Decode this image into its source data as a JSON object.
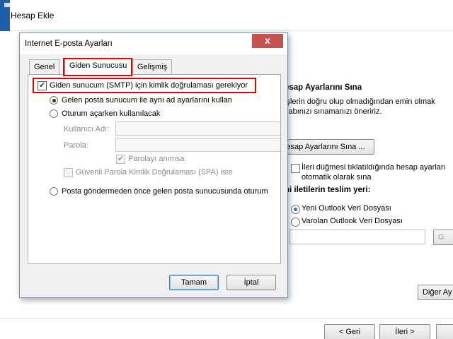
{
  "background_window": {
    "title": "Hesap Ekle",
    "test_heading": "esap Ayarlarını Sına",
    "test_desc_line1": "işlerin doğru olup olmadığından emin olmak",
    "test_desc_line2": "sabınızı sınamanızı öneririz.",
    "test_button_label": "lesap Ayarlarını Sına ...",
    "auto_test_line1": "İleri düğmesi tıklatıldığında hesap ayarları",
    "auto_test_line2": "otomatik olarak sına",
    "deliver_heading": "ni iletilerin teslim yeri:",
    "new_data_file": "Yeni Outlook Veri Dosyası",
    "existing_data_file": "Varolan Outlook Veri Dosyası",
    "browse_label": "G",
    "more_button_label": "Diğer Ay",
    "back_button_label": "< Geri",
    "next_button_label": "İleri >"
  },
  "dialog": {
    "title": "Internet E-posta Ayarları",
    "close_label": "x",
    "tabs": [
      {
        "label": "Genel",
        "active": false
      },
      {
        "label": "Giden Sunucusu",
        "active": true
      },
      {
        "label": "Gelişmiş",
        "active": false
      }
    ],
    "smtp_auth_label": "Giden sunucum (SMTP) için kimlik doğrulaması gerekiyor",
    "smtp_auth_checked": true,
    "same_settings_label": "Gelen posta sunucum ile aynı ad ayarlarını kullan",
    "logon_using_label": "Oturum açarken kullanılacak",
    "username_label": "Kullanıcı Adı:",
    "username_value": "",
    "password_label": "Parola:",
    "password_value": "",
    "remember_password_label": "Parolayı anımsa",
    "spa_label": "Güvenli Parola Kimlik Doğrulaması (SPA) iste",
    "logon_incoming_label": "Posta göndermeden önce gelen posta sunucusunda oturum",
    "ok_label": "Tamam",
    "cancel_label": "İptal"
  },
  "colors": {
    "highlight": "#e00000",
    "close_button": "#c75050",
    "accent": "#2d6fc1"
  }
}
